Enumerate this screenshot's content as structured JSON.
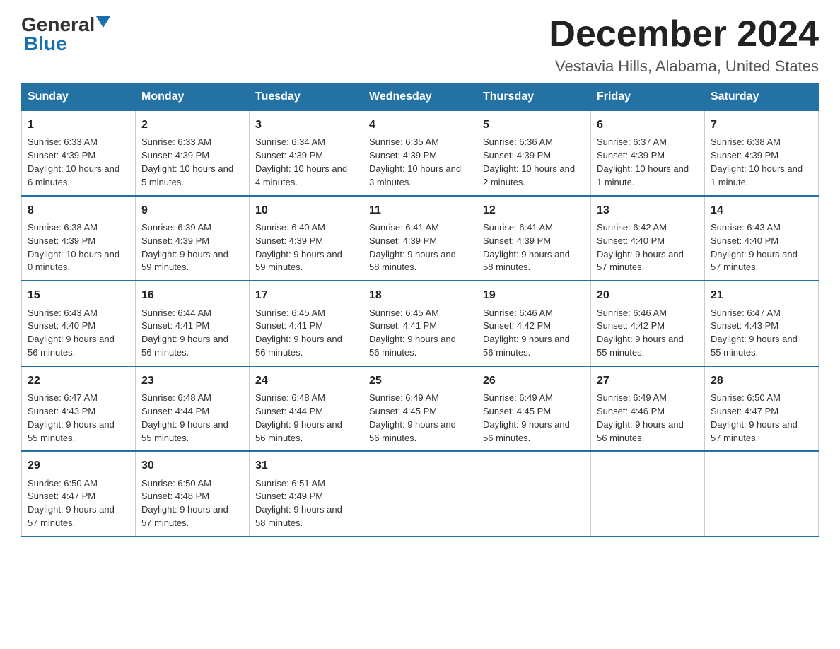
{
  "header": {
    "logo_text_general": "General",
    "logo_text_blue": "Blue",
    "month_year": "December 2024",
    "location": "Vestavia Hills, Alabama, United States"
  },
  "days_of_week": [
    "Sunday",
    "Monday",
    "Tuesday",
    "Wednesday",
    "Thursday",
    "Friday",
    "Saturday"
  ],
  "weeks": [
    [
      {
        "day": "1",
        "sunrise": "6:33 AM",
        "sunset": "4:39 PM",
        "daylight": "10 hours and 6 minutes."
      },
      {
        "day": "2",
        "sunrise": "6:33 AM",
        "sunset": "4:39 PM",
        "daylight": "10 hours and 5 minutes."
      },
      {
        "day": "3",
        "sunrise": "6:34 AM",
        "sunset": "4:39 PM",
        "daylight": "10 hours and 4 minutes."
      },
      {
        "day": "4",
        "sunrise": "6:35 AM",
        "sunset": "4:39 PM",
        "daylight": "10 hours and 3 minutes."
      },
      {
        "day": "5",
        "sunrise": "6:36 AM",
        "sunset": "4:39 PM",
        "daylight": "10 hours and 2 minutes."
      },
      {
        "day": "6",
        "sunrise": "6:37 AM",
        "sunset": "4:39 PM",
        "daylight": "10 hours and 1 minute."
      },
      {
        "day": "7",
        "sunrise": "6:38 AM",
        "sunset": "4:39 PM",
        "daylight": "10 hours and 1 minute."
      }
    ],
    [
      {
        "day": "8",
        "sunrise": "6:38 AM",
        "sunset": "4:39 PM",
        "daylight": "10 hours and 0 minutes."
      },
      {
        "day": "9",
        "sunrise": "6:39 AM",
        "sunset": "4:39 PM",
        "daylight": "9 hours and 59 minutes."
      },
      {
        "day": "10",
        "sunrise": "6:40 AM",
        "sunset": "4:39 PM",
        "daylight": "9 hours and 59 minutes."
      },
      {
        "day": "11",
        "sunrise": "6:41 AM",
        "sunset": "4:39 PM",
        "daylight": "9 hours and 58 minutes."
      },
      {
        "day": "12",
        "sunrise": "6:41 AM",
        "sunset": "4:39 PM",
        "daylight": "9 hours and 58 minutes."
      },
      {
        "day": "13",
        "sunrise": "6:42 AM",
        "sunset": "4:40 PM",
        "daylight": "9 hours and 57 minutes."
      },
      {
        "day": "14",
        "sunrise": "6:43 AM",
        "sunset": "4:40 PM",
        "daylight": "9 hours and 57 minutes."
      }
    ],
    [
      {
        "day": "15",
        "sunrise": "6:43 AM",
        "sunset": "4:40 PM",
        "daylight": "9 hours and 56 minutes."
      },
      {
        "day": "16",
        "sunrise": "6:44 AM",
        "sunset": "4:41 PM",
        "daylight": "9 hours and 56 minutes."
      },
      {
        "day": "17",
        "sunrise": "6:45 AM",
        "sunset": "4:41 PM",
        "daylight": "9 hours and 56 minutes."
      },
      {
        "day": "18",
        "sunrise": "6:45 AM",
        "sunset": "4:41 PM",
        "daylight": "9 hours and 56 minutes."
      },
      {
        "day": "19",
        "sunrise": "6:46 AM",
        "sunset": "4:42 PM",
        "daylight": "9 hours and 56 minutes."
      },
      {
        "day": "20",
        "sunrise": "6:46 AM",
        "sunset": "4:42 PM",
        "daylight": "9 hours and 55 minutes."
      },
      {
        "day": "21",
        "sunrise": "6:47 AM",
        "sunset": "4:43 PM",
        "daylight": "9 hours and 55 minutes."
      }
    ],
    [
      {
        "day": "22",
        "sunrise": "6:47 AM",
        "sunset": "4:43 PM",
        "daylight": "9 hours and 55 minutes."
      },
      {
        "day": "23",
        "sunrise": "6:48 AM",
        "sunset": "4:44 PM",
        "daylight": "9 hours and 55 minutes."
      },
      {
        "day": "24",
        "sunrise": "6:48 AM",
        "sunset": "4:44 PM",
        "daylight": "9 hours and 56 minutes."
      },
      {
        "day": "25",
        "sunrise": "6:49 AM",
        "sunset": "4:45 PM",
        "daylight": "9 hours and 56 minutes."
      },
      {
        "day": "26",
        "sunrise": "6:49 AM",
        "sunset": "4:45 PM",
        "daylight": "9 hours and 56 minutes."
      },
      {
        "day": "27",
        "sunrise": "6:49 AM",
        "sunset": "4:46 PM",
        "daylight": "9 hours and 56 minutes."
      },
      {
        "day": "28",
        "sunrise": "6:50 AM",
        "sunset": "4:47 PM",
        "daylight": "9 hours and 57 minutes."
      }
    ],
    [
      {
        "day": "29",
        "sunrise": "6:50 AM",
        "sunset": "4:47 PM",
        "daylight": "9 hours and 57 minutes."
      },
      {
        "day": "30",
        "sunrise": "6:50 AM",
        "sunset": "4:48 PM",
        "daylight": "9 hours and 57 minutes."
      },
      {
        "day": "31",
        "sunrise": "6:51 AM",
        "sunset": "4:49 PM",
        "daylight": "9 hours and 58 minutes."
      },
      null,
      null,
      null,
      null
    ]
  ],
  "labels": {
    "sunrise": "Sunrise:",
    "sunset": "Sunset:",
    "daylight": "Daylight:"
  }
}
